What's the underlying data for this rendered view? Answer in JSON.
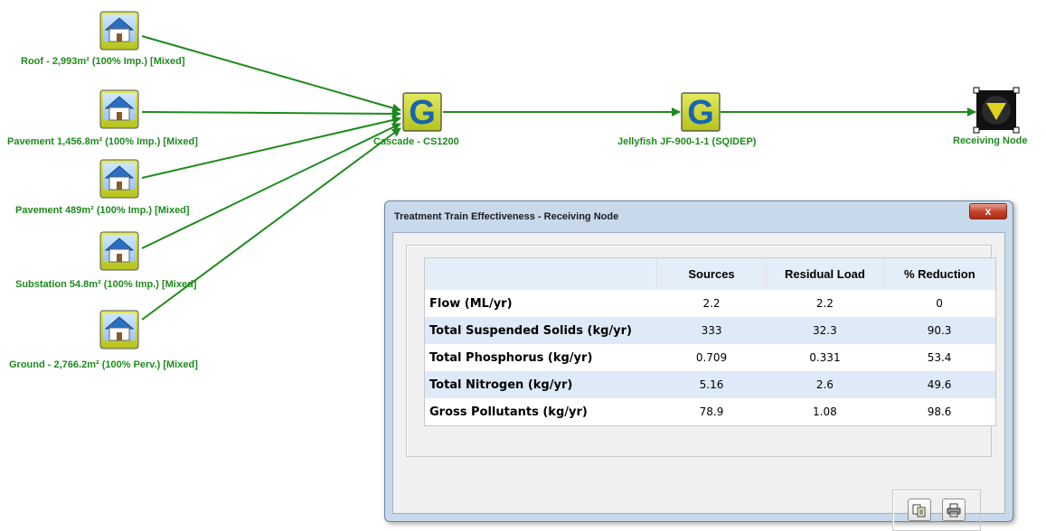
{
  "diagram": {
    "sources": [
      {
        "id": "roof",
        "label": "Roof - 2,993m² (100% Imp.) [Mixed]"
      },
      {
        "id": "pave1",
        "label": "Pavement 1,456.8m² (100% Imp.) [Mixed]"
      },
      {
        "id": "pave2",
        "label": "Pavement 489m² (100% Imp.) [Mixed]"
      },
      {
        "id": "sub",
        "label": "Substation 54.8m² (100% Imp.) [Mixed]"
      },
      {
        "id": "ground",
        "label": "Ground - 2,766.2m² (100% Perv.) [Mixed]"
      }
    ],
    "treatment_nodes": [
      {
        "id": "cascade",
        "label": "Cascade - CS1200",
        "glyph": "G"
      },
      {
        "id": "jellyfish",
        "label": "Jellyfish JF-900-1-1 (SQIDEP)",
        "glyph": "G"
      }
    ],
    "receiving_node": {
      "label": "Receiving Node",
      "glyph": "▼"
    },
    "colors": {
      "link": "#1e8a1e",
      "label": "#1e8a1e",
      "gnode_fill": "#c9d42a",
      "gnode_letter": "#1664b4",
      "source_fill": "#c8d43a"
    }
  },
  "dialog": {
    "title": "Treatment Train Effectiveness - Receiving Node",
    "close_label": "x",
    "columns": [
      "",
      "Sources",
      "Residual Load",
      "% Reduction"
    ],
    "rows": [
      {
        "label": "Flow (ML/yr)",
        "sources": "2.2",
        "residual": "2.2",
        "reduction": "0"
      },
      {
        "label": "Total Suspended Solids (kg/yr)",
        "sources": "333",
        "residual": "32.3",
        "reduction": "90.3"
      },
      {
        "label": "Total Phosphorus (kg/yr)",
        "sources": "0.709",
        "residual": "0.331",
        "reduction": "53.4"
      },
      {
        "label": "Total Nitrogen (kg/yr)",
        "sources": "5.16",
        "residual": "2.6",
        "reduction": "49.6"
      },
      {
        "label": "Gross Pollutants (kg/yr)",
        "sources": "78.9",
        "residual": "1.08",
        "reduction": "98.6"
      }
    ],
    "buttons": {
      "copy_icon": "copy-icon",
      "print_icon": "printer-icon"
    }
  }
}
